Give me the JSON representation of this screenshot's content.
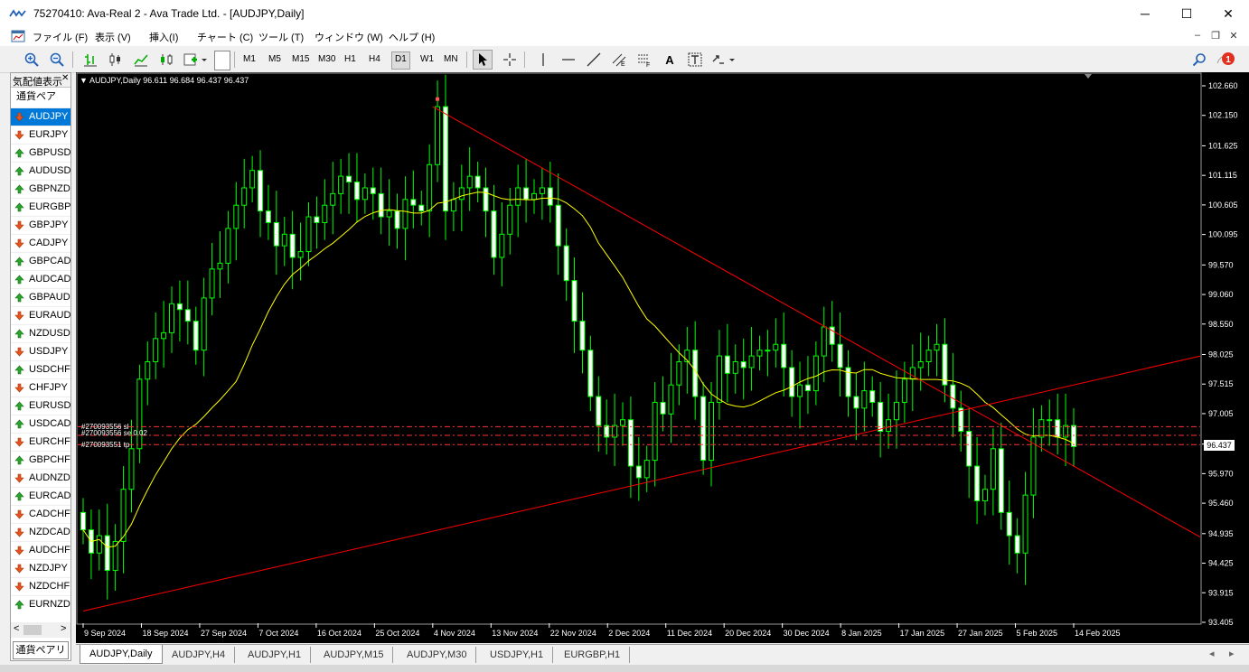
{
  "window": {
    "title": "75270410: Ava-Real 2 - Ava Trade Ltd. - [AUDJPY,Daily]",
    "minimize": "─",
    "maximize": "☐",
    "close": "✕"
  },
  "menu": {
    "items": [
      "ファイル (F)",
      "表示 (V)",
      "挿入(I)",
      "チャート (C)",
      "ツール (T)",
      "ウィンドウ (W)",
      "ヘルプ (H)"
    ]
  },
  "toolbar": {
    "timeframes": [
      "M1",
      "M5",
      "M15",
      "M30",
      "H1",
      "H4",
      "D1",
      "W1",
      "MN"
    ],
    "active_timeframe": "D1",
    "notification_count": "1"
  },
  "market_watch": {
    "title": "気配値表示",
    "column_header": "通貨ペア",
    "symbols": [
      {
        "name": "AUDJPY",
        "dir": "down",
        "selected": true
      },
      {
        "name": "EURJPY",
        "dir": "down"
      },
      {
        "name": "GBPUSD",
        "dir": "up"
      },
      {
        "name": "AUDUSD",
        "dir": "up"
      },
      {
        "name": "GBPNZD",
        "dir": "up"
      },
      {
        "name": "EURGBP",
        "dir": "up"
      },
      {
        "name": "GBPJPY",
        "dir": "down"
      },
      {
        "name": "CADJPY",
        "dir": "down"
      },
      {
        "name": "GBPCAD",
        "dir": "up"
      },
      {
        "name": "AUDCAD",
        "dir": "up"
      },
      {
        "name": "GBPAUD",
        "dir": "up"
      },
      {
        "name": "EURAUD",
        "dir": "down"
      },
      {
        "name": "NZDUSD",
        "dir": "up"
      },
      {
        "name": "USDJPY",
        "dir": "down"
      },
      {
        "name": "USDCHF",
        "dir": "up"
      },
      {
        "name": "CHFJPY",
        "dir": "down"
      },
      {
        "name": "EURUSD",
        "dir": "up"
      },
      {
        "name": "USDCAD",
        "dir": "up"
      },
      {
        "name": "EURCHF",
        "dir": "down"
      },
      {
        "name": "GBPCHF",
        "dir": "up"
      },
      {
        "name": "AUDNZD",
        "dir": "down"
      },
      {
        "name": "EURCAD",
        "dir": "up"
      },
      {
        "name": "CADCHF",
        "dir": "down"
      },
      {
        "name": "NZDCAD",
        "dir": "down"
      },
      {
        "name": "AUDCHF",
        "dir": "down"
      },
      {
        "name": "NZDJPY",
        "dir": "down"
      },
      {
        "name": "NZDCHF",
        "dir": "down"
      },
      {
        "name": "EURNZD",
        "dir": "up"
      }
    ],
    "scroll_left": "<",
    "scroll_right": ">",
    "bottom_tab": "通貨ペアリ"
  },
  "chart": {
    "header": "AUDJPY,Daily  96.611 96.684 96.437 96.437",
    "current_price": "96.437",
    "order_labels": [
      "#270093556 sl",
      "#270093556 se   0.02",
      "#270093551 tp"
    ],
    "colors": {
      "bull": "#00ff00",
      "bear": "#00ff00",
      "ma": "#ffff00",
      "trendline": "#ff0000",
      "orderline": "#ff3333",
      "grid": "#ffffff"
    },
    "chart_data": {
      "type": "candlestick",
      "symbol": "AUDJPY",
      "timeframe": "Daily",
      "ohlc_last": {
        "open": 96.611,
        "high": 96.684,
        "low": 96.437,
        "close": 96.437
      },
      "price_ticks": [
        "102.660",
        "102.150",
        "101.625",
        "101.115",
        "100.605",
        "100.095",
        "99.570",
        "99.060",
        "98.550",
        "98.025",
        "97.515",
        "97.005",
        "96.480",
        "95.970",
        "95.460",
        "94.935",
        "94.425",
        "93.915",
        "93.405"
      ],
      "date_ticks": [
        "9 Sep 2024",
        "18 Sep 2024",
        "27 Sep 2024",
        "7 Oct 2024",
        "16 Oct 2024",
        "25 Oct 2024",
        "4 Nov 2024",
        "13 Nov 2024",
        "22 Nov 2024",
        "2 Dec 2024",
        "11 Dec 2024",
        "20 Dec 2024",
        "30 Dec 2024",
        "8 Jan 2025",
        "17 Jan 2025",
        "27 Jan 2025",
        "5 Feb 2025",
        "14 Feb 2025"
      ],
      "ylim": [
        93.405,
        102.66
      ],
      "closes": [
        95.0,
        94.6,
        94.9,
        94.3,
        94.8,
        95.7,
        96.4,
        97.6,
        97.9,
        98.3,
        98.4,
        98.9,
        98.8,
        98.6,
        98.1,
        99.0,
        99.5,
        99.6,
        100.2,
        100.6,
        100.9,
        101.2,
        100.5,
        100.3,
        99.9,
        100.1,
        99.7,
        99.8,
        100.4,
        100.3,
        100.6,
        100.8,
        101.1,
        101.0,
        100.7,
        100.9,
        100.8,
        100.4,
        100.5,
        100.2,
        100.7,
        100.6,
        100.5,
        101.3,
        102.3,
        100.5,
        100.7,
        100.9,
        101.1,
        100.9,
        100.5,
        99.7,
        100.1,
        100.6,
        100.9,
        100.7,
        100.8,
        100.9,
        100.6,
        99.9,
        99.3,
        98.6,
        98.1,
        97.3,
        96.8,
        96.6,
        96.8,
        96.9,
        96.1,
        95.9,
        96.2,
        97.2,
        97.0,
        97.5,
        97.9,
        98.1,
        97.3,
        96.2,
        97.2,
        98.0,
        97.7,
        97.9,
        97.8,
        98.0,
        98.1,
        98.1,
        98.2,
        97.8,
        97.3,
        97.5,
        97.4,
        98.0,
        98.5,
        98.2,
        97.8,
        97.3,
        97.1,
        97.4,
        97.2,
        96.7,
        96.9,
        97.2,
        97.6,
        97.8,
        97.9,
        98.1,
        98.2,
        97.5,
        97.1,
        96.7,
        96.1,
        95.5,
        95.7,
        96.4,
        95.3,
        94.9,
        94.6,
        95.6,
        96.6,
        96.9,
        96.9,
        96.6,
        96.8,
        96.437
      ],
      "ma_period": 20,
      "trendlines": [
        {
          "from_date": "9 Sep 2024",
          "from_price": 93.6,
          "to_date": "14 Feb 2025",
          "to_price": 97.5
        },
        {
          "from_date": "4 Nov 2024",
          "from_price": 102.3,
          "to_date": "14 Feb 2025",
          "to_price": 96.1
        }
      ],
      "order_levels": [
        96.78,
        96.63,
        96.47
      ]
    }
  },
  "chart_tabs": [
    "AUDJPY,Daily",
    "AUDJPY,H4",
    "AUDJPY,H1",
    "AUDJPY,M15",
    "AUDJPY,M30",
    "USDJPY,H1",
    "EURGBP,H1"
  ],
  "active_chart_tab": "AUDJPY,Daily"
}
